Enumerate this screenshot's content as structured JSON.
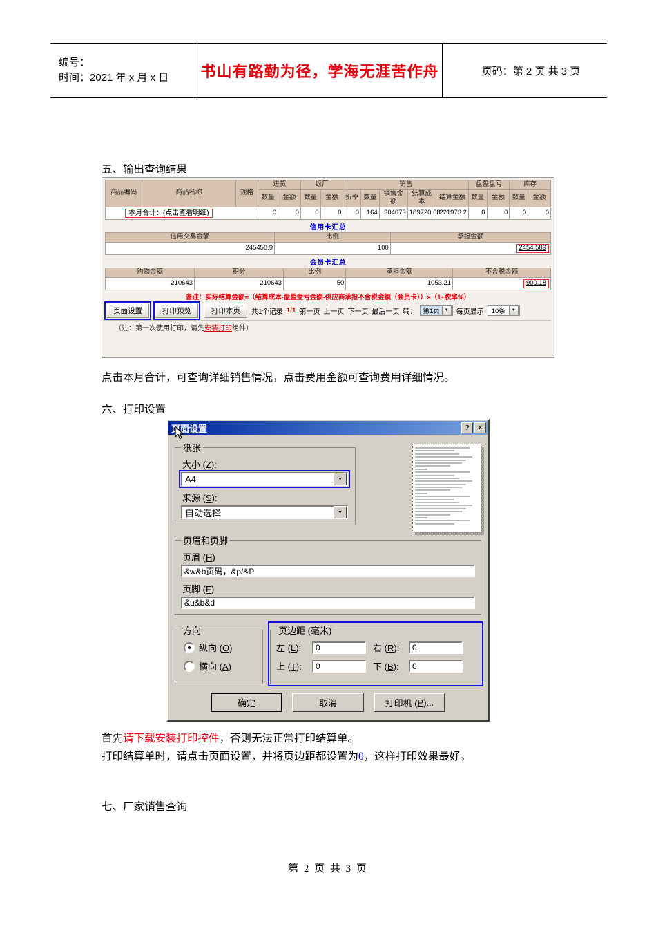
{
  "page_header": {
    "number_label": "编号：",
    "time_label": "时间：2021 年 x 月 x 日",
    "slogan": "书山有路勤为径，学海无涯苦作舟",
    "page_label": "页码：第 2 页 共 3 页"
  },
  "sections": {
    "five": "五、输出查询结果",
    "six": "六、打印设置",
    "seven": "七、厂家销售查询"
  },
  "paragraphs": {
    "after_table": "点击本月合计，可查询详细销售情况，点击费用金额可查询费用详细情况。",
    "tip1_a": "首先",
    "tip1_link": "请下载安装打印控件",
    "tip1_b": "，否则无法正常打印结算单。",
    "tip2_a": "打印结算单时，请点击页面设置，并将页边距都设置为",
    "tip2_zero": "0",
    "tip2_b": "，这样打印效果最好。"
  },
  "result_table": {
    "group_headers": [
      "进货",
      "返厂",
      "销售",
      "盘盈盘亏",
      "库存"
    ],
    "left_headers": [
      "商品编码",
      "商品名称",
      "规格"
    ],
    "sub_headers": [
      "数量",
      "金额",
      "数量",
      "金额",
      "折率",
      "数量",
      "销售金额",
      "结算成本",
      "结算金额",
      "数量",
      "金额",
      "数量",
      "金额"
    ],
    "row_label": "本月合计：(点击查看明细)",
    "row_values": [
      "0",
      "0",
      "0",
      "0",
      "0",
      "164",
      "304073",
      "189720.68",
      "221973.2",
      "0",
      "0",
      "0",
      "0"
    ]
  },
  "credit_summary": {
    "title": "信用卡汇总",
    "headers": [
      "信用交易金额",
      "比例",
      "承担金额"
    ],
    "values": [
      "245458.9",
      "100",
      "2454.589"
    ]
  },
  "member_summary": {
    "title": "会员卡汇总",
    "headers": [
      "购物金额",
      "积分",
      "比例",
      "承担金额",
      "不含税金额"
    ],
    "values": [
      "210643",
      "210643",
      "50",
      "1053.21",
      "900.18"
    ]
  },
  "remark": "备注：实际结算金额=（结算成本-盘盈盘亏金额-供应商承担不含税金额（会员卡））×（1+税率%）",
  "toolbar": {
    "page_setup": "页面设置",
    "print_preview": "打印预览",
    "print_page": "打印本页",
    "record_total": "共1个记录",
    "record_pages": "1/1",
    "first": "第一页",
    "prev": "上一页",
    "next": "下一页",
    "last": "最后一页",
    "goto_label": "转：",
    "goto_value": "第1页",
    "per_page_label": "每页显示",
    "per_page_value": "10条"
  },
  "bottom_note": {
    "a": "（注：第一次使用打印，请先",
    "link": "安装打印",
    "b": "组件）"
  },
  "dialog": {
    "title": "页面设置",
    "help_btn": "?",
    "close_btn": "✕",
    "paper_group": "纸张",
    "size_label_a": "大小 (",
    "size_label_key": "Z",
    "size_label_b": "):",
    "size_value": "A4",
    "source_label_a": "来源 (",
    "source_label_key": "S",
    "source_label_b": "):",
    "source_value": "自动选择",
    "hf_group": "页眉和页脚",
    "header_label_a": "页眉 (",
    "header_label_key": "H",
    "header_label_b": ")",
    "header_value": "&w&b页码，&p/&P",
    "footer_label_a": "页脚 (",
    "footer_label_key": "F",
    "footer_label_b": ")",
    "footer_value": "&u&b&d",
    "orient_group": "方向",
    "portrait_a": "纵向 (",
    "portrait_key": "O",
    "portrait_b": ")",
    "landscape_a": "横向 (",
    "landscape_key": "A",
    "landscape_b": ")",
    "margin_group": "页边距 (毫米)",
    "margin_left_a": "左 (",
    "margin_left_key": "L",
    "margin_left_b": "):",
    "margin_left_value": "0",
    "margin_right_a": "右 (",
    "margin_right_key": "R",
    "margin_right_b": "):",
    "margin_right_value": "0",
    "margin_top_a": "上 (",
    "margin_top_key": "T",
    "margin_top_b": "):",
    "margin_top_value": "0",
    "margin_bottom_a": "下 (",
    "margin_bottom_key": "B",
    "margin_bottom_b": "):",
    "margin_bottom_value": "0",
    "ok": "确定",
    "cancel": "取消",
    "printer_a": "打印机 (",
    "printer_key": "P",
    "printer_b": ")..."
  },
  "footer": "第 2 页 共 3 页"
}
